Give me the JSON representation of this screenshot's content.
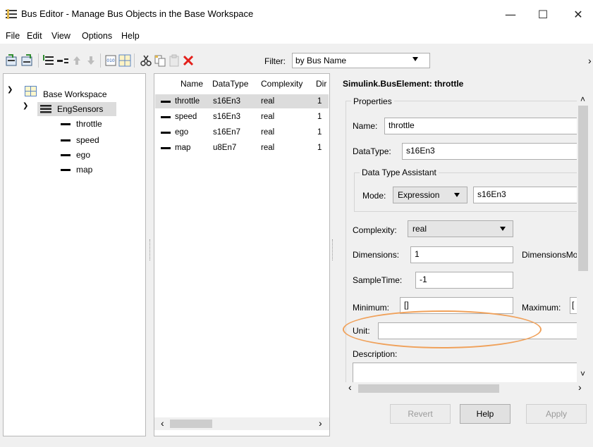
{
  "window": {
    "title": "Bus Editor - Manage Bus Objects in the Base Workspace",
    "minimize_glyph": "—",
    "maximize_glyph": "☐",
    "close_glyph": "✕"
  },
  "menu": [
    "File",
    "Edit",
    "View",
    "Options",
    "Help"
  ],
  "toolbar": {
    "filter_label": "Filter:",
    "filter_value": "by Bus Name",
    "overflow_glyph": "›"
  },
  "tree": {
    "root": "Base Workspace",
    "bus": "EngSensors",
    "elements": [
      "throttle",
      "speed",
      "ego",
      "map"
    ]
  },
  "list": {
    "headers": [
      "Name",
      "DataType",
      "Complexity",
      "Dir"
    ],
    "rows": [
      {
        "name": "throttle",
        "datatype": "s16En3",
        "complexity": "real",
        "dim": "1"
      },
      {
        "name": "speed",
        "datatype": "s16En3",
        "complexity": "real",
        "dim": "1"
      },
      {
        "name": "ego",
        "datatype": "s16En7",
        "complexity": "real",
        "dim": "1"
      },
      {
        "name": "map",
        "datatype": "u8En7",
        "complexity": "real",
        "dim": "1"
      }
    ]
  },
  "properties": {
    "heading": "Simulink.BusElement: throttle",
    "group_label": "Properties",
    "name_label": "Name:",
    "name_value": "throttle",
    "datatype_label": "DataType:",
    "datatype_value": "s16En3",
    "assistant_label": "Data Type Assistant",
    "mode_label": "Mode:",
    "mode_value": "Expression",
    "mode_expr": "s16En3",
    "complexity_label": "Complexity:",
    "complexity_value": "real",
    "dimensions_label": "Dimensions:",
    "dimensions_value": "1",
    "dimensionsmode_label": "DimensionsMo",
    "sampletime_label": "SampleTime:",
    "sampletime_value": "-1",
    "minimum_label": "Minimum:",
    "minimum_value": "[]",
    "maximum_label": "Maximum:",
    "maximum_value": "[",
    "unit_label": "Unit:",
    "unit_value": "",
    "description_label": "Description:",
    "description_value": ""
  },
  "buttons": {
    "revert": "Revert",
    "help": "Help",
    "apply": "Apply"
  },
  "scroll": {
    "left": "‹",
    "right": "›",
    "up": "˄",
    "down": "˅"
  },
  "colors": {
    "highlight_oval": "#f0a15a",
    "tree_selection": "#dcdcdc"
  }
}
